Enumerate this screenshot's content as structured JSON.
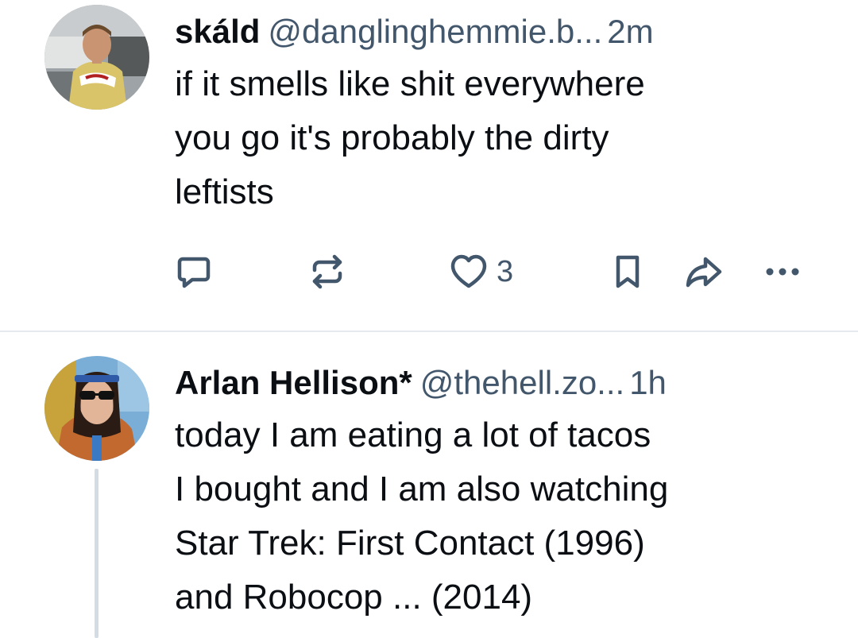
{
  "posts": [
    {
      "display_name": "skáld",
      "handle": "@danglinghemmie.b...",
      "time": "2m",
      "text": "if it smells like shit everywhere\nyou go it's probably the dirty\nleftists",
      "like_count": "3",
      "avatar_icon": "user-avatar-racing-driver",
      "colors": {
        "text": "#0b0f14",
        "muted": "#42576c"
      }
    },
    {
      "display_name": "Arlan Hellison*",
      "handle": "@thehell.zo...",
      "time": "1h",
      "text": "today I am eating a lot of tacos\nI bought and I am also watching\nStar Trek: First Contact (1996)\nand Robocop ... (2014)",
      "avatar_icon": "user-avatar-sunglasses"
    }
  ],
  "icons": {
    "reply": "reply-icon",
    "repost": "repost-icon",
    "like": "heart-icon",
    "bookmark": "bookmark-icon",
    "share": "share-icon",
    "more": "more-icon"
  }
}
